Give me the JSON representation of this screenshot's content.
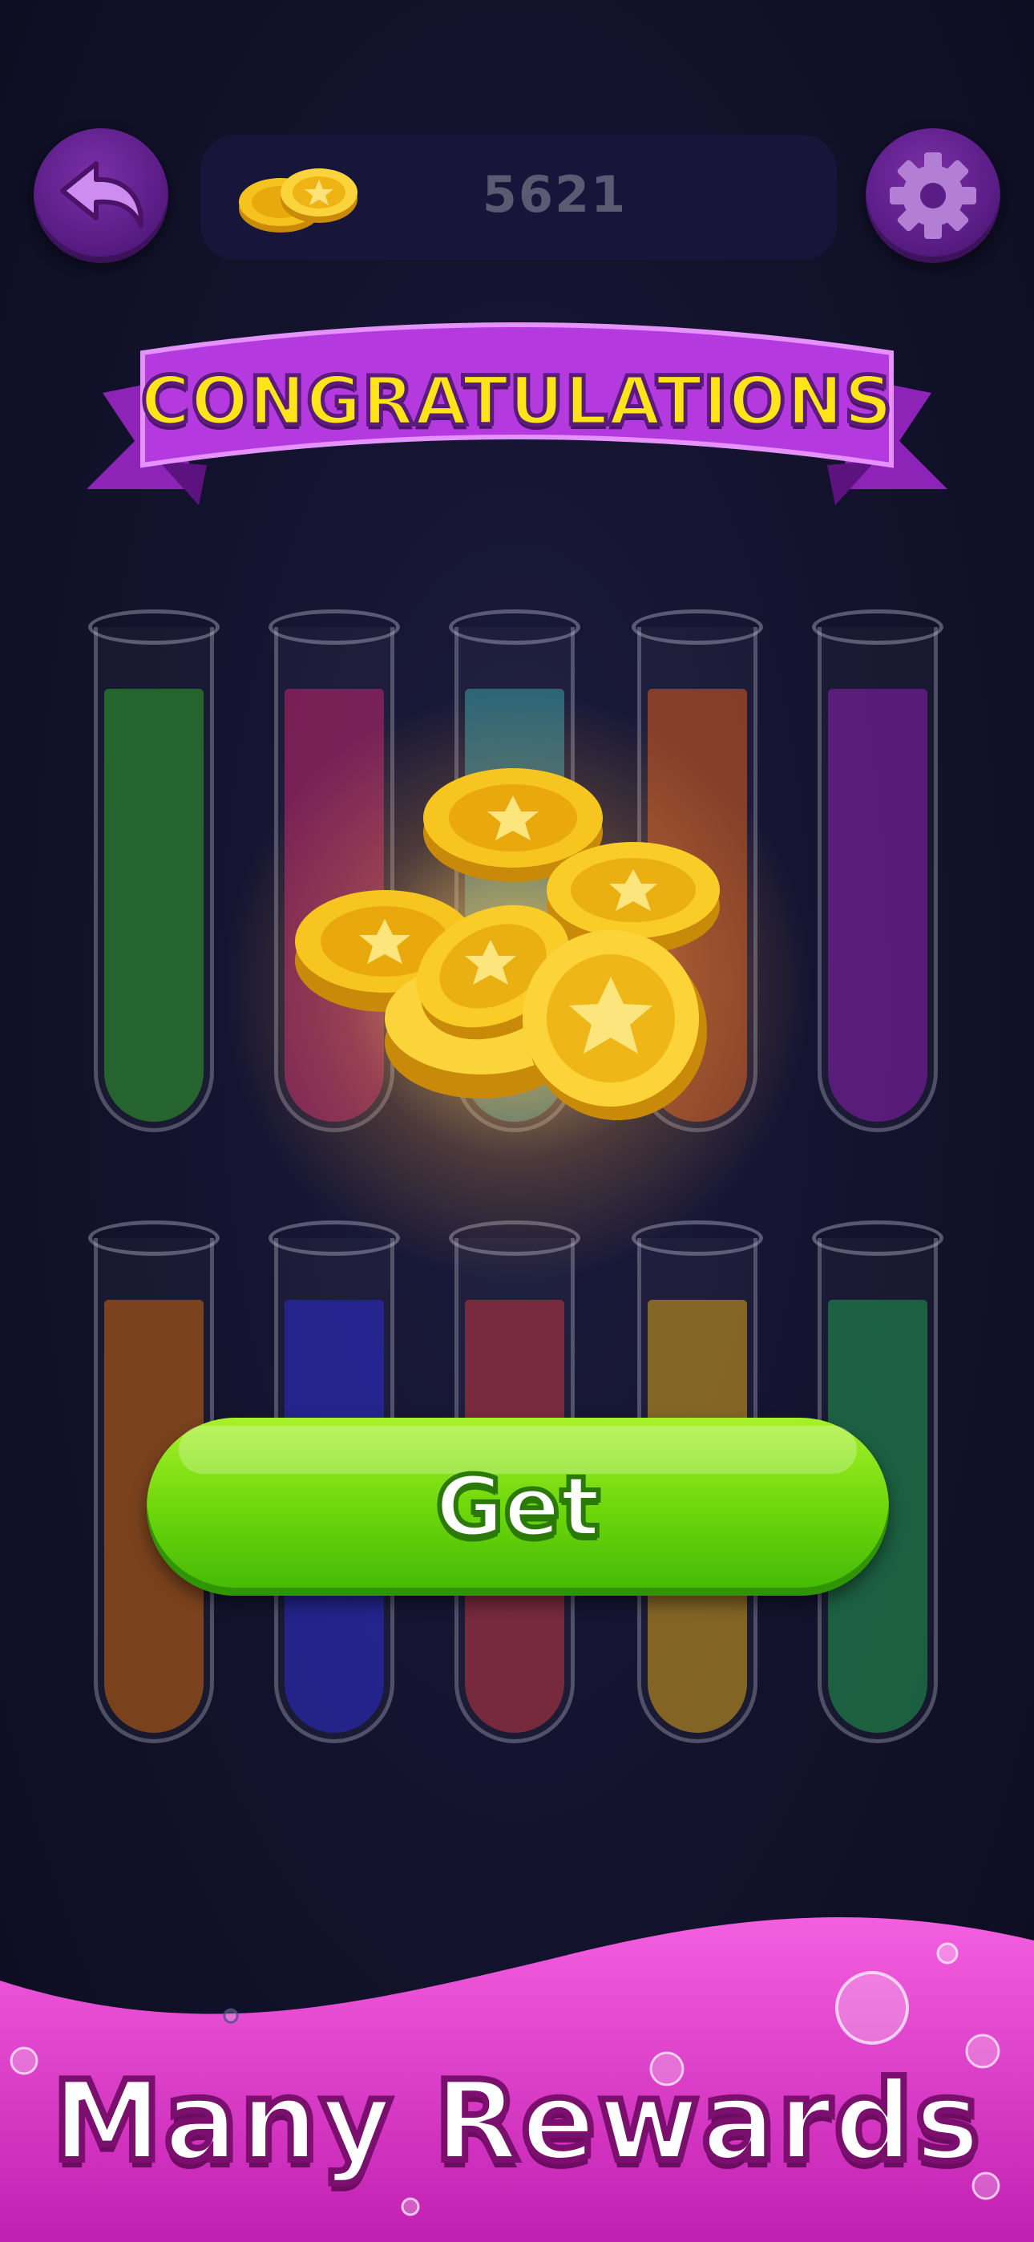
{
  "top_bar": {
    "coin_count": "5621",
    "back_icon": "back-arrow-icon",
    "settings_icon": "gear-icon"
  },
  "banner": {
    "title": "CONGRATULATIONS"
  },
  "tubes_row1": [
    {
      "color": "#2fa12a",
      "fill": 0.88
    },
    {
      "color": "#c2246f",
      "fill": 0.88
    },
    {
      "color": "#3a9fa5",
      "fill": 0.88
    },
    {
      "color": "#d8581c",
      "fill": 0.88
    },
    {
      "color": "#8a1fb0",
      "fill": 0.88
    }
  ],
  "tubes_row2": [
    {
      "color": "#c9640d",
      "fill": 0.88
    },
    {
      "color": "#2b2ad1",
      "fill": 0.88
    },
    {
      "color": "#c0353e",
      "fill": 0.88
    },
    {
      "color": "#d8a117",
      "fill": 0.88
    },
    {
      "color": "#1f9a4e",
      "fill": 0.88
    }
  ],
  "reward": {
    "icon": "gold-coins-pile-icon"
  },
  "get_button": {
    "label": "Get"
  },
  "promo": {
    "title": "Many Rewards"
  }
}
